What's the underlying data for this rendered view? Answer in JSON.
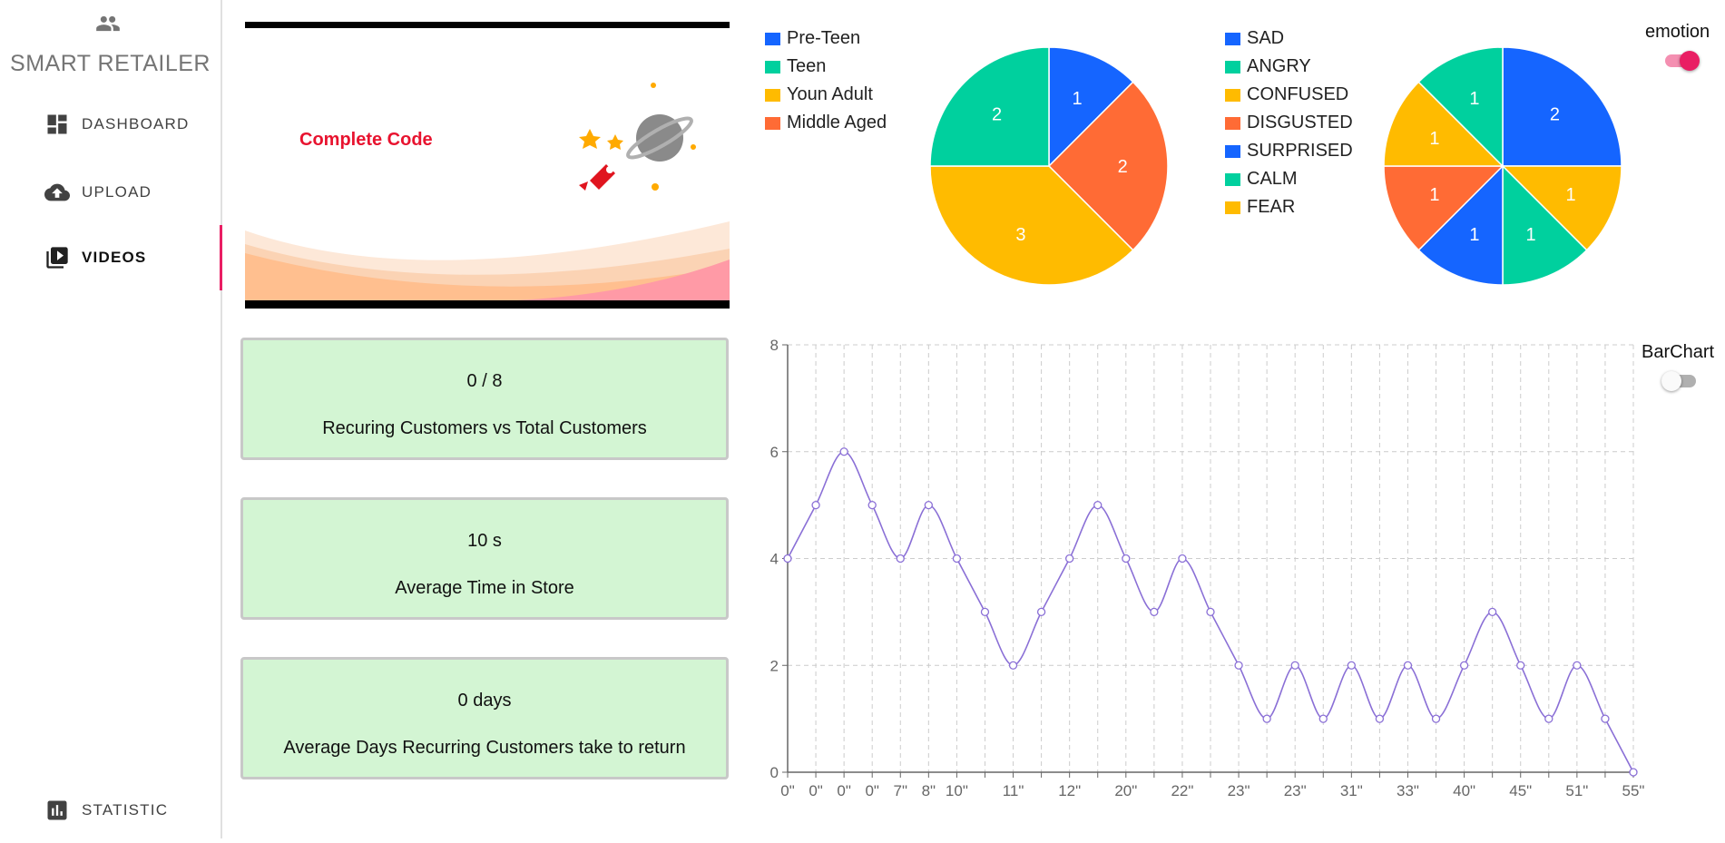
{
  "sidebar": {
    "brand_title": "SMART RETAILER",
    "brand_icon": "people-icon",
    "items": [
      {
        "label": "DASHBOARD",
        "icon": "dashboard-icon",
        "active": false
      },
      {
        "label": "UPLOAD",
        "icon": "cloud-upload-icon",
        "active": false
      },
      {
        "label": "VIDEOS",
        "icon": "video-library-icon",
        "active": true
      },
      {
        "label": "STATISTIC",
        "icon": "bar-chart-icon",
        "active": false
      }
    ],
    "accent_color": "#e91e63"
  },
  "video": {
    "caption": "Complete Code"
  },
  "stats": [
    {
      "value": "0 / 8",
      "label": "Recuring Customers vs Total Customers"
    },
    {
      "value": "10 s",
      "label": "Average Time in Store"
    },
    {
      "value": "0 days",
      "label": "Average Days Recurring Customers take to return"
    }
  ],
  "toggles": {
    "emotion": {
      "label": "emotion",
      "on": true
    },
    "barchart": {
      "label": "BarChart",
      "on": false
    }
  },
  "colors": {
    "blue": "#1565ff",
    "teal": "#00d09e",
    "yellow": "#ffbb00",
    "orange": "#ff6b35",
    "card_bg": "#d3f5d3",
    "line": "#8a6fd6"
  },
  "chart_data": [
    {
      "type": "pie",
      "legend_position": "left",
      "labels": [
        "Pre-Teen",
        "Teen",
        "Youn Adult",
        "Middle Aged"
      ],
      "values": [
        1,
        2,
        3,
        2
      ],
      "colors": [
        "#1565ff",
        "#00d09e",
        "#ffbb00",
        "#ff6b35"
      ]
    },
    {
      "type": "pie",
      "legend_position": "left",
      "labels": [
        "SAD",
        "ANGRY",
        "CONFUSED",
        "DISGUSTED",
        "SURPRISED",
        "CALM",
        "FEAR"
      ],
      "values": [
        2,
        1,
        1,
        1,
        1,
        1,
        1
      ],
      "slices": [
        {
          "value": 2,
          "color": "#1565ff"
        },
        {
          "value": 1,
          "color": "#ffbb00"
        },
        {
          "value": 1,
          "color": "#00d09e"
        },
        {
          "value": 1,
          "color": "#1565ff"
        },
        {
          "value": 1,
          "color": "#ff6b35"
        },
        {
          "value": 1,
          "color": "#ffbb00"
        },
        {
          "value": 1,
          "color": "#00d09e"
        }
      ],
      "colors": [
        "#1565ff",
        "#00d09e",
        "#ffbb00",
        "#ff6b35",
        "#1565ff",
        "#00d09e",
        "#ffbb00"
      ]
    },
    {
      "type": "line",
      "x": [
        "0\"",
        "0\"",
        "0\"",
        "0\"",
        "7\"",
        "8\"",
        "10\"",
        "",
        "11\"",
        "",
        "12\"",
        "",
        "20\"",
        "",
        "22\"",
        "",
        "23\"",
        "",
        "23\"",
        "",
        "31\"",
        "",
        "33\"",
        "",
        "40\"",
        "",
        "45\"",
        "",
        "51\"",
        "",
        "55\""
      ],
      "values": [
        4,
        5,
        6,
        5,
        4,
        5,
        4,
        3,
        2,
        3,
        4,
        5,
        4,
        3,
        4,
        3,
        2,
        1,
        2,
        1,
        2,
        1,
        2,
        1,
        2,
        3,
        2,
        1,
        2,
        1,
        0
      ],
      "ylim": [
        0,
        8
      ],
      "yticks": [
        0,
        2,
        4,
        6,
        8
      ],
      "grid": true,
      "color": "#8a6fd6"
    }
  ]
}
